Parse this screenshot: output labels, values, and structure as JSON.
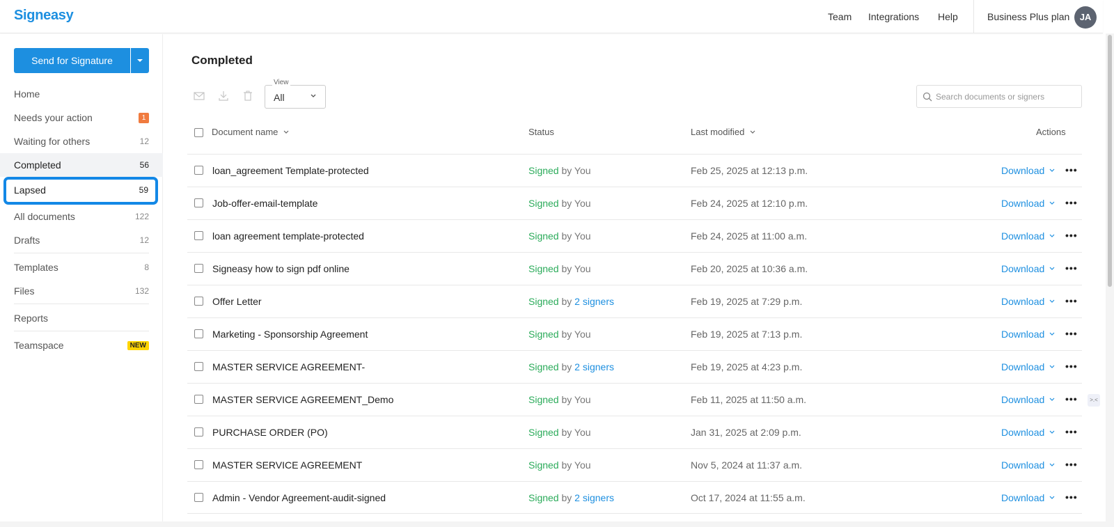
{
  "header": {
    "logo": "Signeasy",
    "nav": [
      "Team",
      "Integrations",
      "Help"
    ],
    "plan": "Business Plus plan",
    "avatar_initials": "JA"
  },
  "sidebar": {
    "send_button": "Send for Signature",
    "items": [
      {
        "label": "Home",
        "count": ""
      },
      {
        "label": "Needs your action",
        "count": "1"
      },
      {
        "label": "Waiting for others",
        "count": "12"
      },
      {
        "label": "Completed",
        "count": "56"
      },
      {
        "label": "Lapsed",
        "count": "59"
      },
      {
        "label": "All documents",
        "count": "122"
      },
      {
        "label": "Drafts",
        "count": "12"
      },
      {
        "label": "Templates",
        "count": "8"
      },
      {
        "label": "Files",
        "count": "132"
      },
      {
        "label": "Reports",
        "count": ""
      },
      {
        "label": "Teamspace",
        "count": "NEW"
      }
    ]
  },
  "main": {
    "title": "Completed",
    "view": {
      "label": "View",
      "value": "All"
    },
    "search": {
      "placeholder": "Search documents or signers"
    },
    "columns": {
      "name": "Document name",
      "status": "Status",
      "modified": "Last modified",
      "actions": "Actions"
    },
    "rows": [
      {
        "name": "loan_agreement Template-protected",
        "status": "Signed",
        "by": "by",
        "signer": "You",
        "date": "Feb 25, 2025 at 12:13 p.m.",
        "action": "Download"
      },
      {
        "name": "Job-offer-email-template",
        "status": "Signed",
        "by": "by",
        "signer": "You",
        "date": "Feb 24, 2025 at 12:10 p.m.",
        "action": "Download"
      },
      {
        "name": "loan agreement template-protected",
        "status": "Signed",
        "by": "by",
        "signer": "You",
        "date": "Feb 24, 2025 at 11:00 a.m.",
        "action": "Download"
      },
      {
        "name": "Signeasy how to sign pdf online",
        "status": "Signed",
        "by": "by",
        "signer": "You",
        "date": "Feb 20, 2025 at 10:36 a.m.",
        "action": "Download"
      },
      {
        "name": "Offer Letter",
        "status": "Signed",
        "by": "by",
        "signer": "2 signers",
        "date": "Feb 19, 2025 at 7:29 p.m.",
        "action": "Download"
      },
      {
        "name": "Marketing - Sponsorship Agreement",
        "status": "Signed",
        "by": "by",
        "signer": "You",
        "date": "Feb 19, 2025 at 7:13 p.m.",
        "action": "Download"
      },
      {
        "name": "MASTER SERVICE AGREEMENT-",
        "status": "Signed",
        "by": "by",
        "signer": "2 signers",
        "date": "Feb 19, 2025 at 4:23 p.m.",
        "action": "Download"
      },
      {
        "name": "MASTER SERVICE AGREEMENT_Demo",
        "status": "Signed",
        "by": "by",
        "signer": "You",
        "date": "Feb 11, 2025 at 11:50 a.m.",
        "action": "Download"
      },
      {
        "name": "PURCHASE ORDER (PO)",
        "status": "Signed",
        "by": "by",
        "signer": "You",
        "date": "Jan 31, 2025 at 2:09 p.m.",
        "action": "Download"
      },
      {
        "name": "MASTER SERVICE AGREEMENT",
        "status": "Signed",
        "by": "by",
        "signer": "You",
        "date": "Nov 5, 2024 at 11:37 a.m.",
        "action": "Download"
      },
      {
        "name": "Admin - Vendor Agreement-audit-signed",
        "status": "Signed",
        "by": "by",
        "signer": "2 signers",
        "date": "Oct 17, 2024 at 11:55 a.m.",
        "action": "Download"
      }
    ]
  },
  "colors": {
    "brand": "#1d8fe0",
    "signed": "#2bab5a",
    "highlight": "#1388e6",
    "badge": "#f07b3f",
    "new_badge": "#ffd400"
  }
}
